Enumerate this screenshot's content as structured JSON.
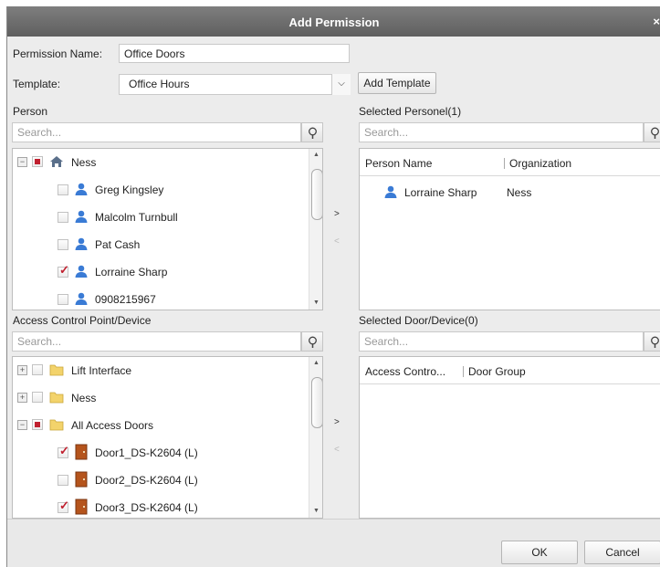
{
  "dialog": {
    "title": "Add Permission",
    "close_glyph": "×"
  },
  "form": {
    "permission_name_label": "Permission Name:",
    "permission_name_value": "Office Doors",
    "template_label": "Template:",
    "template_value": "Office Hours",
    "add_template_label": "Add Template"
  },
  "person": {
    "label": "Person",
    "search_placeholder": "Search...",
    "root": {
      "name": "Ness",
      "state": "partial",
      "expander": "−"
    },
    "items": [
      {
        "name": "Greg Kingsley",
        "checked": false
      },
      {
        "name": "Malcolm Turnbull",
        "checked": false
      },
      {
        "name": "Pat Cash",
        "checked": false
      },
      {
        "name": "Lorraine Sharp",
        "checked": true
      },
      {
        "name": "0908215967",
        "checked": false
      }
    ]
  },
  "selected_personel": {
    "label": "Selected Personel(1)",
    "search_placeholder": "Search...",
    "columns": [
      "Person Name",
      "Organization"
    ],
    "rows": [
      {
        "person": "Lorraine Sharp",
        "organization": "Ness"
      }
    ]
  },
  "access_points": {
    "label": "Access Control Point/Device",
    "search_placeholder": "Search...",
    "groups": [
      {
        "name": "Lift Interface",
        "expander": "+",
        "state": "unchecked"
      },
      {
        "name": "Ness",
        "expander": "+",
        "state": "unchecked"
      },
      {
        "name": "All Access Doors",
        "expander": "−",
        "state": "partial"
      }
    ],
    "doors": [
      {
        "name": "Door1_DS-K2604 (L)",
        "checked": true
      },
      {
        "name": "Door2_DS-K2604 (L)",
        "checked": false
      },
      {
        "name": "Door3_DS-K2604 (L)",
        "checked": true
      }
    ]
  },
  "selected_doors": {
    "label": "Selected Door/Device(0)",
    "search_placeholder": "Search...",
    "columns": [
      "Access Contro...",
      "Door Group"
    ]
  },
  "transfer": {
    "add_glyph": ">",
    "remove_glyph": "<"
  },
  "footer": {
    "ok_label": "OK",
    "cancel_label": "Cancel"
  },
  "colors": {
    "accent_red": "#c0202f",
    "person_icon": "#3a7bd5",
    "folder": "#f3d36b",
    "door": "#b5541c"
  }
}
